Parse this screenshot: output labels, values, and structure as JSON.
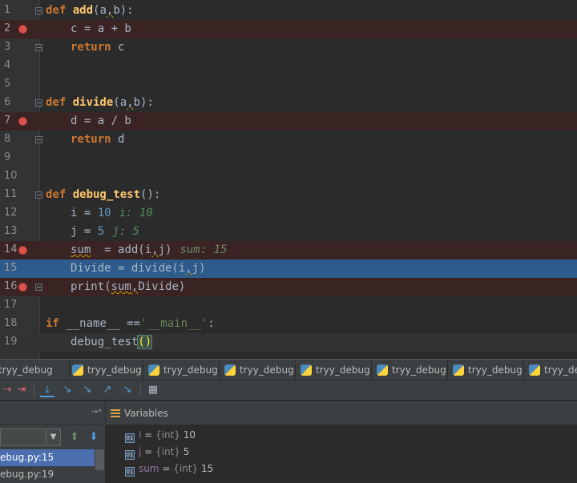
{
  "editor": {
    "lines": [
      {
        "n": "1",
        "tokens": [
          [
            "kw",
            "def "
          ],
          [
            "fn",
            "add"
          ],
          [
            "",
            "(a"
          ],
          [
            "squig",
            ","
          ],
          [
            "",
            "b):"
          ]
        ],
        "indent": 0,
        "bp": false,
        "fold": true
      },
      {
        "n": "2",
        "tokens": [
          [
            "",
            "c = a + b"
          ]
        ],
        "indent": 1,
        "bp": true
      },
      {
        "n": "3",
        "tokens": [
          [
            "kw",
            "return "
          ],
          [
            "",
            "c"
          ]
        ],
        "indent": 1,
        "bp": false,
        "fold": true
      },
      {
        "n": "4",
        "tokens": [],
        "indent": 0
      },
      {
        "n": "5",
        "tokens": [],
        "indent": 0
      },
      {
        "n": "6",
        "tokens": [
          [
            "kw",
            "def "
          ],
          [
            "fn",
            "divide"
          ],
          [
            "",
            "(a"
          ],
          [
            "squig",
            ","
          ],
          [
            "",
            "b):"
          ]
        ],
        "indent": 0,
        "fold": true
      },
      {
        "n": "7",
        "tokens": [
          [
            "",
            "d = a / b"
          ]
        ],
        "indent": 1,
        "bp": true
      },
      {
        "n": "8",
        "tokens": [
          [
            "kw",
            "return "
          ],
          [
            "",
            "d"
          ]
        ],
        "indent": 1,
        "fold": true
      },
      {
        "n": "9",
        "tokens": [],
        "indent": 0
      },
      {
        "n": "10",
        "tokens": [],
        "indent": 0
      },
      {
        "n": "11",
        "tokens": [
          [
            "kw",
            "def "
          ],
          [
            "fn",
            "debug_test"
          ],
          [
            "",
            "():"
          ]
        ],
        "indent": 0,
        "fold": true
      },
      {
        "n": "12",
        "tokens": [
          [
            "",
            "i = "
          ],
          [
            "num",
            "10"
          ]
        ],
        "indent": 1,
        "inline": "i: 10"
      },
      {
        "n": "13",
        "tokens": [
          [
            "",
            "j = "
          ],
          [
            "num",
            "5"
          ]
        ],
        "indent": 1,
        "inline": "j: 5"
      },
      {
        "n": "14",
        "tokens": [
          [
            "squig",
            "sum"
          ],
          [
            "",
            ""
          ],
          [
            "",
            "  = add(i"
          ],
          [
            "squig",
            ","
          ],
          [
            "",
            "j)"
          ]
        ],
        "indent": 1,
        "bp": true,
        "inline": "sum: 15"
      },
      {
        "n": "15",
        "tokens": [
          [
            "",
            "Divide = divide(i"
          ],
          [
            "squig",
            ","
          ],
          [
            "",
            "j)"
          ]
        ],
        "indent": 1,
        "exec": true
      },
      {
        "n": "16",
        "tokens": [
          [
            "",
            "print("
          ],
          [
            "squig",
            "sum"
          ],
          [
            "squig",
            ","
          ],
          [
            "",
            "Divide)"
          ]
        ],
        "indent": 1,
        "bp": true,
        "fold": true
      },
      {
        "n": "17",
        "tokens": [],
        "indent": 0
      },
      {
        "n": "18",
        "tokens": [
          [
            "kw",
            "if "
          ],
          [
            "",
            "__name__ =="
          ],
          [
            "str",
            "'__main__'"
          ],
          [
            "",
            ":"
          ]
        ],
        "indent": 0
      },
      {
        "n": "19",
        "tokens": [
          [
            "",
            "debug_test"
          ],
          [
            "paren",
            "()"
          ]
        ],
        "indent": 1,
        "caret": true
      }
    ]
  },
  "tabs": [
    "tryy_debug",
    "tryy_debug",
    "tryy_debug",
    "tryy_debug",
    "tryy_debug",
    "tryy_debug",
    "tryy_debug",
    "tryy_debug"
  ],
  "toolbar": {
    "icons": [
      "show-execution-point-icon",
      "step-over-icon",
      "step-into-icon",
      "step-into-my-code-icon",
      "force-step-into-icon",
      "step-out-icon",
      "run-to-cursor-icon",
      "evaluate-expression-icon"
    ]
  },
  "frames": {
    "header_hint": "→*",
    "items": [
      {
        "label": "ebug.py:15",
        "selected": true
      },
      {
        "label": "ebug.py:19",
        "selected": false
      }
    ]
  },
  "variables": {
    "title": "Variables",
    "items": [
      {
        "name": "i",
        "type": "{int}",
        "value": "10"
      },
      {
        "name": "j",
        "type": "{int}",
        "value": "5"
      },
      {
        "name": "sum",
        "type": "{int}",
        "value": "15"
      }
    ]
  }
}
